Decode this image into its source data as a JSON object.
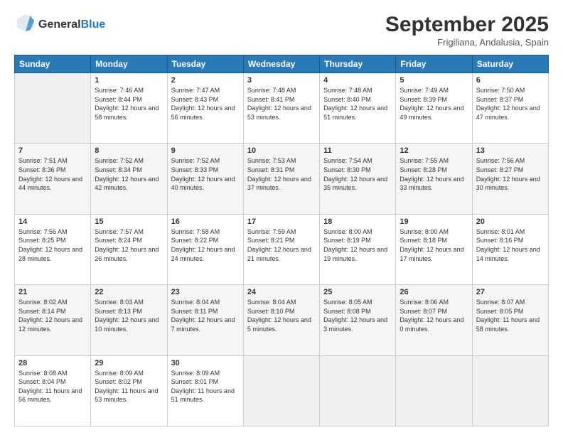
{
  "header": {
    "logo_general": "General",
    "logo_blue": "Blue",
    "month": "September 2025",
    "location": "Frigiliana, Andalusia, Spain"
  },
  "weekdays": [
    "Sunday",
    "Monday",
    "Tuesday",
    "Wednesday",
    "Thursday",
    "Friday",
    "Saturday"
  ],
  "weeks": [
    [
      {
        "day": "",
        "empty": true
      },
      {
        "day": "1",
        "sunrise": "7:46 AM",
        "sunset": "8:44 PM",
        "daylight": "12 hours and 58 minutes."
      },
      {
        "day": "2",
        "sunrise": "7:47 AM",
        "sunset": "8:43 PM",
        "daylight": "12 hours and 56 minutes."
      },
      {
        "day": "3",
        "sunrise": "7:48 AM",
        "sunset": "8:41 PM",
        "daylight": "12 hours and 53 minutes."
      },
      {
        "day": "4",
        "sunrise": "7:48 AM",
        "sunset": "8:40 PM",
        "daylight": "12 hours and 51 minutes."
      },
      {
        "day": "5",
        "sunrise": "7:49 AM",
        "sunset": "8:39 PM",
        "daylight": "12 hours and 49 minutes."
      },
      {
        "day": "6",
        "sunrise": "7:50 AM",
        "sunset": "8:37 PM",
        "daylight": "12 hours and 47 minutes."
      }
    ],
    [
      {
        "day": "7",
        "sunrise": "7:51 AM",
        "sunset": "8:36 PM",
        "daylight": "12 hours and 44 minutes."
      },
      {
        "day": "8",
        "sunrise": "7:52 AM",
        "sunset": "8:34 PM",
        "daylight": "12 hours and 42 minutes."
      },
      {
        "day": "9",
        "sunrise": "7:52 AM",
        "sunset": "8:33 PM",
        "daylight": "12 hours and 40 minutes."
      },
      {
        "day": "10",
        "sunrise": "7:53 AM",
        "sunset": "8:31 PM",
        "daylight": "12 hours and 37 minutes."
      },
      {
        "day": "11",
        "sunrise": "7:54 AM",
        "sunset": "8:30 PM",
        "daylight": "12 hours and 35 minutes."
      },
      {
        "day": "12",
        "sunrise": "7:55 AM",
        "sunset": "8:28 PM",
        "daylight": "12 hours and 33 minutes."
      },
      {
        "day": "13",
        "sunrise": "7:56 AM",
        "sunset": "8:27 PM",
        "daylight": "12 hours and 30 minutes."
      }
    ],
    [
      {
        "day": "14",
        "sunrise": "7:56 AM",
        "sunset": "8:25 PM",
        "daylight": "12 hours and 28 minutes."
      },
      {
        "day": "15",
        "sunrise": "7:57 AM",
        "sunset": "8:24 PM",
        "daylight": "12 hours and 26 minutes."
      },
      {
        "day": "16",
        "sunrise": "7:58 AM",
        "sunset": "8:22 PM",
        "daylight": "12 hours and 24 minutes."
      },
      {
        "day": "17",
        "sunrise": "7:59 AM",
        "sunset": "8:21 PM",
        "daylight": "12 hours and 21 minutes."
      },
      {
        "day": "18",
        "sunrise": "8:00 AM",
        "sunset": "8:19 PM",
        "daylight": "12 hours and 19 minutes."
      },
      {
        "day": "19",
        "sunrise": "8:00 AM",
        "sunset": "8:18 PM",
        "daylight": "12 hours and 17 minutes."
      },
      {
        "day": "20",
        "sunrise": "8:01 AM",
        "sunset": "8:16 PM",
        "daylight": "12 hours and 14 minutes."
      }
    ],
    [
      {
        "day": "21",
        "sunrise": "8:02 AM",
        "sunset": "8:14 PM",
        "daylight": "12 hours and 12 minutes."
      },
      {
        "day": "22",
        "sunrise": "8:03 AM",
        "sunset": "8:13 PM",
        "daylight": "12 hours and 10 minutes."
      },
      {
        "day": "23",
        "sunrise": "8:04 AM",
        "sunset": "8:11 PM",
        "daylight": "12 hours and 7 minutes."
      },
      {
        "day": "24",
        "sunrise": "8:04 AM",
        "sunset": "8:10 PM",
        "daylight": "12 hours and 5 minutes."
      },
      {
        "day": "25",
        "sunrise": "8:05 AM",
        "sunset": "8:08 PM",
        "daylight": "12 hours and 3 minutes."
      },
      {
        "day": "26",
        "sunrise": "8:06 AM",
        "sunset": "8:07 PM",
        "daylight": "12 hours and 0 minutes."
      },
      {
        "day": "27",
        "sunrise": "8:07 AM",
        "sunset": "8:05 PM",
        "daylight": "11 hours and 58 minutes."
      }
    ],
    [
      {
        "day": "28",
        "sunrise": "8:08 AM",
        "sunset": "8:04 PM",
        "daylight": "11 hours and 56 minutes."
      },
      {
        "day": "29",
        "sunrise": "8:09 AM",
        "sunset": "8:02 PM",
        "daylight": "11 hours and 53 minutes."
      },
      {
        "day": "30",
        "sunrise": "8:09 AM",
        "sunset": "8:01 PM",
        "daylight": "11 hours and 51 minutes."
      },
      {
        "day": "",
        "empty": true
      },
      {
        "day": "",
        "empty": true
      },
      {
        "day": "",
        "empty": true
      },
      {
        "day": "",
        "empty": true
      }
    ]
  ]
}
